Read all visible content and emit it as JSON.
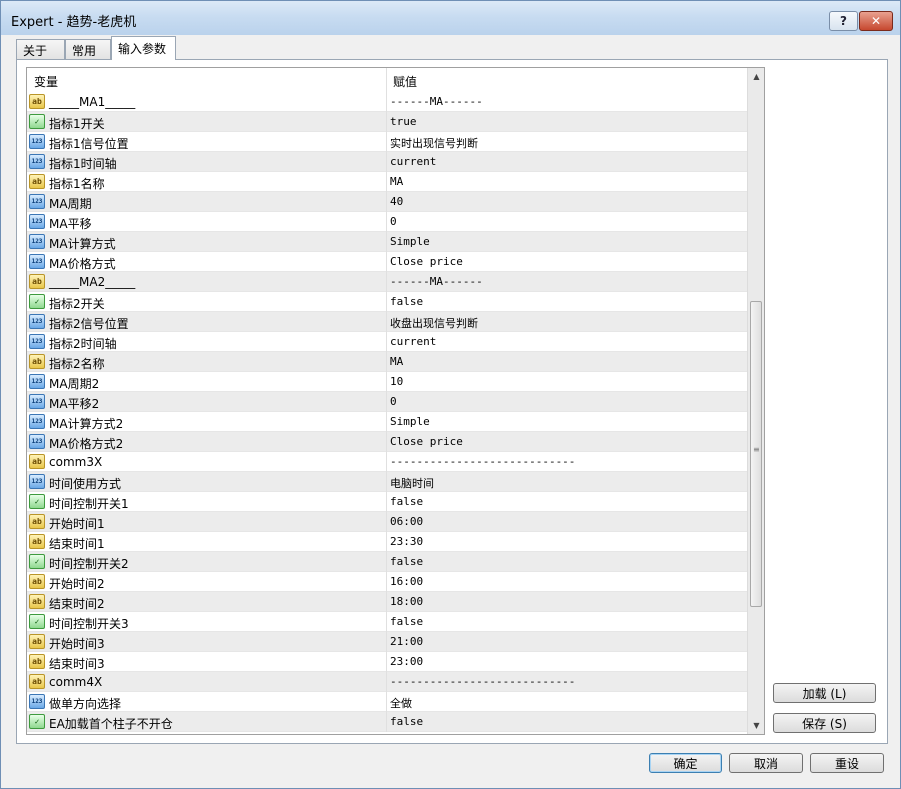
{
  "window": {
    "title": "Expert - 趋势-老虎机",
    "help_label": "?",
    "close_label": "✕"
  },
  "tabs": [
    {
      "label": "关于"
    },
    {
      "label": "常用"
    },
    {
      "label": "输入参数"
    }
  ],
  "grid": {
    "header_variable": "变量",
    "header_value": "赋值",
    "rows": [
      {
        "type": "ab",
        "name": "_____MA1_____",
        "value": "------MA------"
      },
      {
        "type": "bool",
        "name": "指标1开关",
        "value": "true"
      },
      {
        "type": "num",
        "name": "指标1信号位置",
        "value": "实时出现信号判断"
      },
      {
        "type": "num",
        "name": "指标1时间轴",
        "value": "current"
      },
      {
        "type": "ab",
        "name": "指标1名称",
        "value": "MA"
      },
      {
        "type": "num",
        "name": "MA周期",
        "value": "40"
      },
      {
        "type": "num",
        "name": "MA平移",
        "value": "0"
      },
      {
        "type": "num",
        "name": "MA计算方式",
        "value": "Simple"
      },
      {
        "type": "num",
        "name": "MA价格方式",
        "value": "Close price"
      },
      {
        "type": "ab",
        "name": "_____MA2_____",
        "value": "------MA------"
      },
      {
        "type": "bool",
        "name": "指标2开关",
        "value": "false"
      },
      {
        "type": "num",
        "name": "指标2信号位置",
        "value": "收盘出现信号判断"
      },
      {
        "type": "num",
        "name": "指标2时间轴",
        "value": "current"
      },
      {
        "type": "ab",
        "name": "指标2名称",
        "value": "MA"
      },
      {
        "type": "num",
        "name": "MA周期2",
        "value": "10"
      },
      {
        "type": "num",
        "name": "MA平移2",
        "value": "0"
      },
      {
        "type": "num",
        "name": "MA计算方式2",
        "value": "Simple"
      },
      {
        "type": "num",
        "name": "MA价格方式2",
        "value": "Close price"
      },
      {
        "type": "ab",
        "name": "comm3X",
        "value": "----------------------------"
      },
      {
        "type": "num",
        "name": "时间使用方式",
        "value": "电脑时间"
      },
      {
        "type": "bool",
        "name": "时间控制开关1",
        "value": "false"
      },
      {
        "type": "ab",
        "name": "开始时间1",
        "value": "06:00"
      },
      {
        "type": "ab",
        "name": "结束时间1",
        "value": "23:30"
      },
      {
        "type": "bool",
        "name": "时间控制开关2",
        "value": "false"
      },
      {
        "type": "ab",
        "name": "开始时间2",
        "value": "16:00"
      },
      {
        "type": "ab",
        "name": "结束时间2",
        "value": "18:00"
      },
      {
        "type": "bool",
        "name": "时间控制开关3",
        "value": "false"
      },
      {
        "type": "ab",
        "name": "开始时间3",
        "value": "21:00"
      },
      {
        "type": "ab",
        "name": "结束时间3",
        "value": "23:00"
      },
      {
        "type": "ab",
        "name": "comm4X",
        "value": "----------------------------"
      },
      {
        "type": "num",
        "name": "做单方向选择",
        "value": "全做"
      },
      {
        "type": "bool",
        "name": "EA加载首个柱子不开仓",
        "value": "false"
      }
    ]
  },
  "icons": {
    "ab": "ab",
    "num": "123",
    "bool": "✓"
  },
  "buttons": {
    "load": "加载 (L)",
    "save": "保存 (S)",
    "ok": "确定",
    "cancel": "取消",
    "reset": "重设"
  },
  "colors": {
    "titlebar": "#c8dcf1",
    "alt_row": "#ececec",
    "close_button": "#c6482f"
  }
}
